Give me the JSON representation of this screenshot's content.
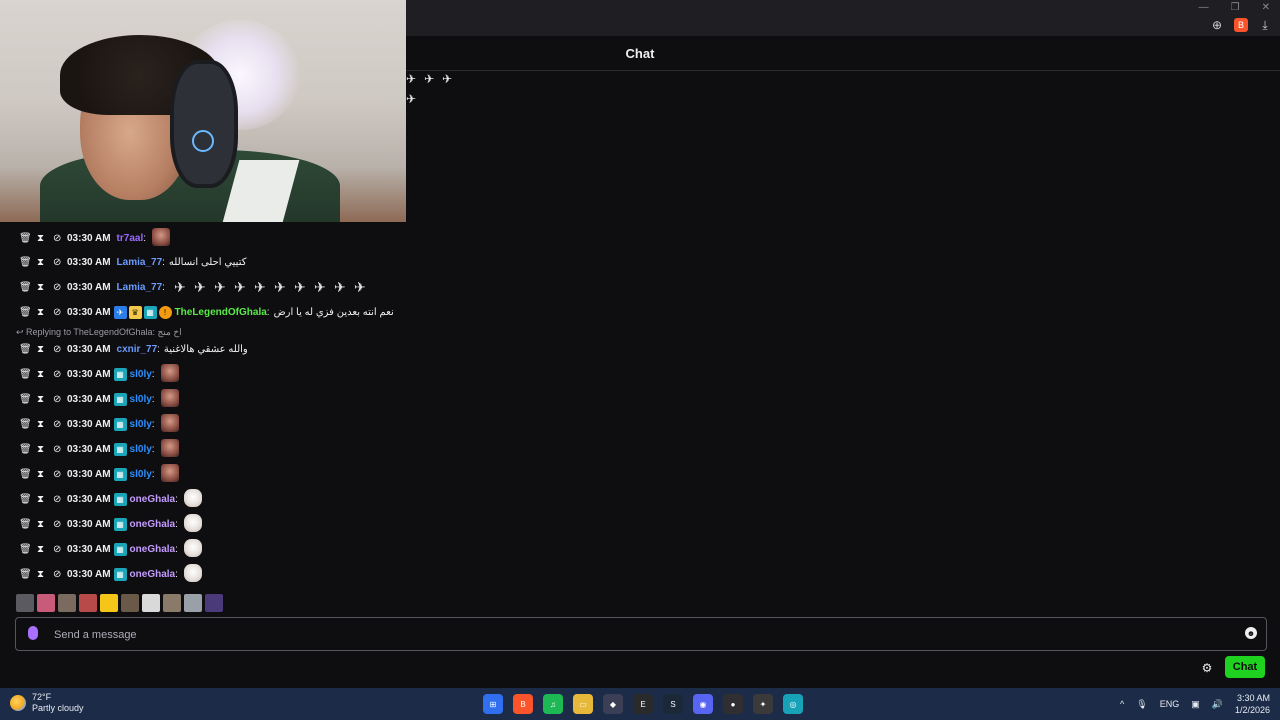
{
  "browser": {
    "window_controls": {
      "minimize": "—",
      "maximize": "❐",
      "close": "✕"
    },
    "tools": {
      "zoom": "⊕",
      "brave": "B",
      "download": "⤓"
    }
  },
  "header": {
    "title": "Chat"
  },
  "top_emote_glyph": "✈",
  "messages": [
    {
      "time": "03:30 AM",
      "user": "tr7aal",
      "user_color": "#9b6bff",
      "badges": [],
      "text": "",
      "emotes": [
        "face"
      ]
    },
    {
      "time": "03:30 AM",
      "user": "Lamia_77",
      "user_color": "#6b9bff",
      "badges": [],
      "text": "كتييي احلى انسالله",
      "emotes": []
    },
    {
      "time": "03:30 AM",
      "user": "Lamia_77",
      "user_color": "#6b9bff",
      "badges": [],
      "text": "",
      "emotes": [
        "bird",
        "bird",
        "bird",
        "bird",
        "bird",
        "bird",
        "bird",
        "bird",
        "bird",
        "bird"
      ]
    },
    {
      "time": "03:30 AM",
      "user": "TheLegendOfGhala",
      "user_color": "#5bea4a",
      "badges": [
        "bl",
        "cr",
        "tl",
        "or"
      ],
      "text": "نعم انته بعدين فزي له يا ارض",
      "emotes": []
    },
    {
      "time": "03:30 AM",
      "user": "cxnir_77",
      "user_color": "#6b9bff",
      "badges": [],
      "text": "والله عشقي هالاغنية",
      "emotes": []
    },
    {
      "time": "03:30 AM",
      "user": "sl0ly",
      "user_color": "#2b8fff",
      "badges": [
        "tl"
      ],
      "text": "",
      "emotes": [
        "face"
      ]
    },
    {
      "time": "03:30 AM",
      "user": "sl0ly",
      "user_color": "#2b8fff",
      "badges": [
        "tl"
      ],
      "text": "",
      "emotes": [
        "face"
      ]
    },
    {
      "time": "03:30 AM",
      "user": "sl0ly",
      "user_color": "#2b8fff",
      "badges": [
        "tl"
      ],
      "text": "",
      "emotes": [
        "face"
      ]
    },
    {
      "time": "03:30 AM",
      "user": "sl0ly",
      "user_color": "#2b8fff",
      "badges": [
        "tl"
      ],
      "text": "",
      "emotes": [
        "face"
      ]
    },
    {
      "time": "03:30 AM",
      "user": "sl0ly",
      "user_color": "#2b8fff",
      "badges": [
        "tl"
      ],
      "text": "",
      "emotes": [
        "face"
      ]
    },
    {
      "time": "03:30 AM",
      "user": "oneGhala",
      "user_color": "#c49bff",
      "badges": [
        "tl"
      ],
      "text": "",
      "emotes": [
        "cat"
      ]
    },
    {
      "time": "03:30 AM",
      "user": "oneGhala",
      "user_color": "#c49bff",
      "badges": [
        "tl"
      ],
      "text": "",
      "emotes": [
        "cat"
      ]
    },
    {
      "time": "03:30 AM",
      "user": "oneGhala",
      "user_color": "#c49bff",
      "badges": [
        "tl"
      ],
      "text": "",
      "emotes": [
        "cat"
      ]
    },
    {
      "time": "03:30 AM",
      "user": "oneGhala",
      "user_color": "#c49bff",
      "badges": [
        "tl"
      ],
      "text": "",
      "emotes": [
        "cat"
      ]
    }
  ],
  "reply": {
    "label": "Replying to TheLegendOfGhala:",
    "quoted": "اخ منج"
  },
  "recent_emote_colors": [
    "#5a5a60",
    "#c95b7a",
    "#7a6b5e",
    "#b84a4a",
    "#f5c518",
    "#6a5848",
    "#d9d9d9",
    "#8a7a6a",
    "#9aa0a8",
    "#4a3a7a"
  ],
  "input": {
    "placeholder": "Send a message"
  },
  "actions": {
    "chat_button": "Chat",
    "settings_icon": "⚙",
    "emote_picker_icon": "☻"
  },
  "taskbar": {
    "weather_temp": "72°F",
    "weather_desc": "Partly cloudy",
    "apps": [
      {
        "name": "start",
        "color": "#2f6ff0",
        "glyph": "⊞"
      },
      {
        "name": "brave",
        "color": "#fb542b",
        "glyph": "B"
      },
      {
        "name": "spotify",
        "color": "#1db954",
        "glyph": "♫"
      },
      {
        "name": "files",
        "color": "#e8b83a",
        "glyph": "▭"
      },
      {
        "name": "davinci",
        "color": "#3a3f55",
        "glyph": "◆"
      },
      {
        "name": "epic",
        "color": "#2a2a2a",
        "glyph": "E"
      },
      {
        "name": "steam",
        "color": "#1b2838",
        "glyph": "S"
      },
      {
        "name": "discord",
        "color": "#5865f2",
        "glyph": "◉"
      },
      {
        "name": "obs",
        "color": "#302e31",
        "glyph": "●"
      },
      {
        "name": "steelseries",
        "color": "#3a3a3a",
        "glyph": "✦"
      },
      {
        "name": "app",
        "color": "#17a2b8",
        "glyph": "◎"
      }
    ],
    "tray": {
      "chevron": "^",
      "mic": "🎙",
      "lang": "ENG",
      "display": "▣",
      "volume": "🔊"
    },
    "time": "3:30 AM",
    "date": "1/2/2026"
  }
}
